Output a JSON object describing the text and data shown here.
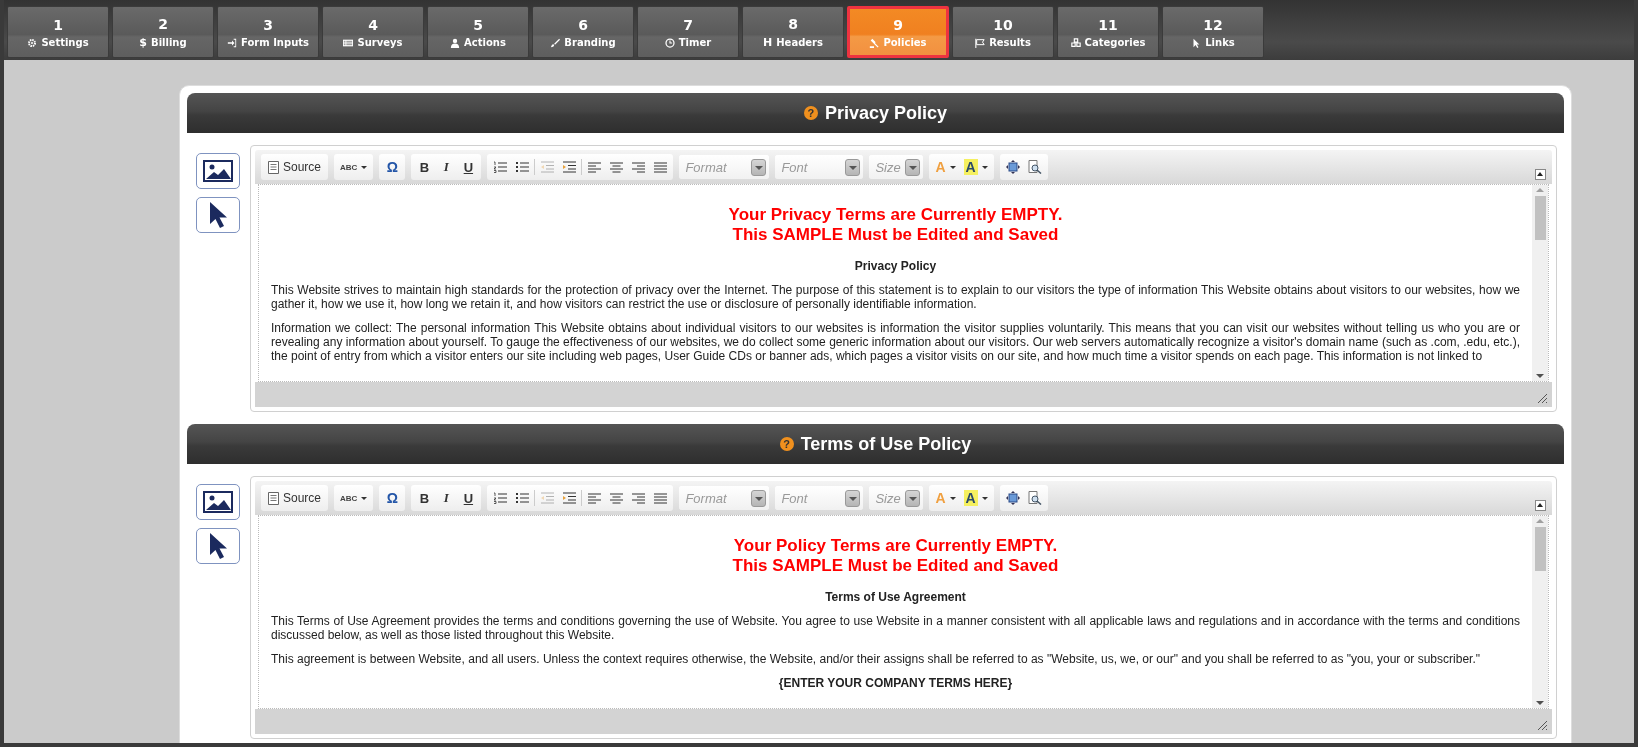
{
  "tabs": [
    {
      "number": "1",
      "label": "Settings",
      "kind": "gear",
      "selected": false
    },
    {
      "number": "2",
      "label": "Billing",
      "kind": "glyph",
      "glyph": "$",
      "selected": false
    },
    {
      "number": "3",
      "label": "Form Inputs",
      "kind": "sign-in",
      "selected": false
    },
    {
      "number": "4",
      "label": "Surveys",
      "kind": "list",
      "selected": false
    },
    {
      "number": "5",
      "label": "Actions",
      "kind": "user",
      "selected": false
    },
    {
      "number": "6",
      "label": "Branding",
      "kind": "brush",
      "selected": false
    },
    {
      "number": "7",
      "label": "Timer",
      "kind": "clock",
      "selected": false
    },
    {
      "number": "8",
      "label": "Headers",
      "kind": "glyph",
      "glyph": "H",
      "selected": false
    },
    {
      "number": "9",
      "label": "Policies",
      "kind": "gavel",
      "selected": true
    },
    {
      "number": "10",
      "label": "Results",
      "kind": "flag",
      "selected": false
    },
    {
      "number": "11",
      "label": "Categories",
      "kind": "cubes",
      "selected": false
    },
    {
      "number": "12",
      "label": "Links",
      "kind": "pointer",
      "selected": false
    }
  ],
  "sections": [
    {
      "title": "Privacy Policy",
      "help": "?",
      "toolbar": {
        "source": "Source",
        "spell": "ABC",
        "omega": "Ω",
        "bold": "B",
        "italic": "I",
        "underline": "U",
        "format": "Format",
        "font": "Font",
        "size": "Size",
        "text_color": "A",
        "bg_color": "A",
        "outdent_disabled": true
      },
      "notice": [
        "Your Privacy Terms are Currently EMPTY.",
        "This SAMPLE Must be Edited and Saved"
      ],
      "doc_title": "Privacy Policy",
      "paragraphs": [
        {
          "kind": "text",
          "text": "This Website strives to maintain high standards for the protection of privacy over the Internet. The purpose of this statement is to explain to our visitors the type of information This Website obtains about visitors to our websites, how we gather it, how we use it, how long we retain it, and how visitors can restrict the use or disclosure of personally identifiable information."
        },
        {
          "kind": "text",
          "text": "Information we collect: The personal information This Website obtains about individual visitors to our websites is information the visitor supplies voluntarily. This means that you can visit our websites without telling us who you are or revealing any information about yourself. To gauge the effectiveness of our websites, we do collect some generic information about our visitors. Our web servers automatically recognize a visitor's domain name (such as .com, .edu, etc.), the point of entry from which a visitor enters our site including web pages, User Guide CDs or banner ads, which pages a visitor visits on our site, and how much time a visitor spends on each page. This information is not linked to"
        }
      ]
    },
    {
      "title": "Terms of Use Policy",
      "help": "?",
      "toolbar": {
        "source": "Source",
        "spell": "ABC",
        "omega": "Ω",
        "bold": "B",
        "italic": "I",
        "underline": "U",
        "format": "Format",
        "font": "Font",
        "size": "Size",
        "text_color": "A",
        "bg_color": "A",
        "outdent_disabled": true
      },
      "notice": [
        "Your Policy Terms are Currently EMPTY.",
        "This SAMPLE Must be Edited and Saved"
      ],
      "doc_title": "Terms of Use Agreement",
      "paragraphs": [
        {
          "kind": "text",
          "text": "This Terms of Use Agreement provides the terms and conditions governing the use of Website. You agree to use Website in a manner consistent with all applicable laws and regulations and in accordance with the terms and conditions discussed below, as well as those listed throughout this Website."
        },
        {
          "kind": "text",
          "text": "This agreement is between Website, and all users. Unless the context requires otherwise, the Website, and/or their assigns shall be referred to as \"Website, us, we, or our\" and you shall be referred to as \"you, your or subscriber.\""
        },
        {
          "kind": "heading",
          "text": "{ENTER YOUR COMPANY TERMS HERE}"
        }
      ]
    }
  ]
}
